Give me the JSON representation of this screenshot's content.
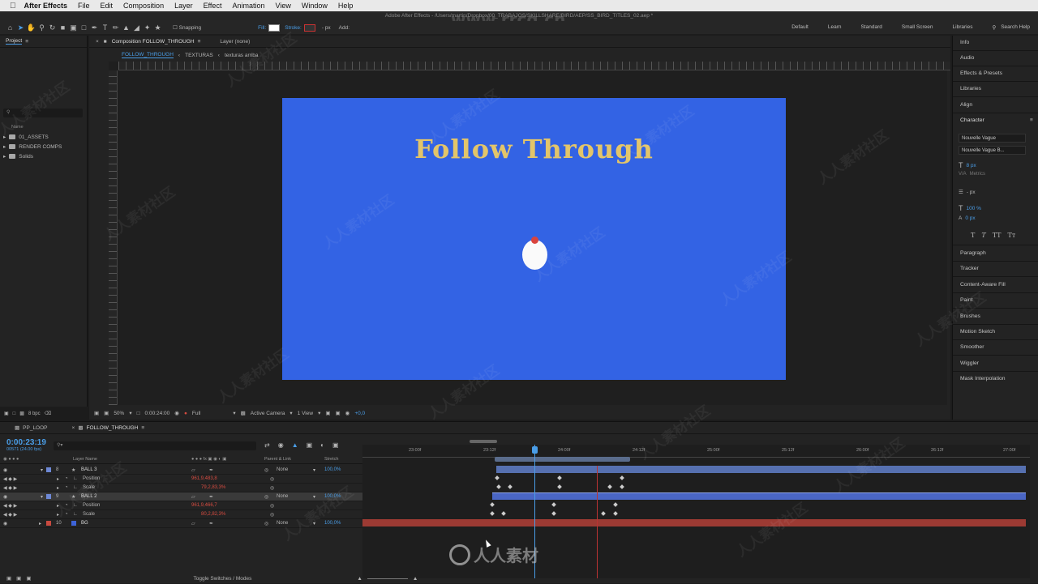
{
  "menubar": {
    "app_name": "After Effects",
    "items": [
      "File",
      "Edit",
      "Composition",
      "Layer",
      "Effect",
      "Animation",
      "View",
      "Window",
      "Help"
    ]
  },
  "window_title": "Adobe After Effects - /Users/martin/Dropbox/00_TRABAJOS/SKILLSHARE/BIRD/AEP/SS_BIRD_TITLES_02.aep *",
  "toolbar": {
    "snapping": "Snapping",
    "fill_label": "Fill:",
    "stroke_label": "Stroke:",
    "stroke_px": "- px",
    "add_label": "Add:",
    "workspaces": [
      "Default",
      "Learn",
      "Standard",
      "Small Screen",
      "Libraries"
    ],
    "search_help": "Search Help"
  },
  "project": {
    "tab": "Project",
    "col_name": "Name",
    "items": [
      "01_ASSETS",
      "RENDER COMPS",
      "Solids"
    ],
    "bpc": "8 bpc"
  },
  "comp": {
    "tab": "Composition FOLLOW_THROUGH",
    "layer_tab": "Layer (none)",
    "breadcrumbs": [
      "FOLLOW_THROUGH",
      "TEXTURAS",
      "texturas arriba"
    ],
    "title_text": "Follow Through",
    "zoom": "50%",
    "timecode": "0:00:24:00",
    "resolution": "Full",
    "camera": "Active Camera",
    "views": "1 View",
    "exposure": "+0,0"
  },
  "right_panel": {
    "items": [
      "Info",
      "Audio",
      "Effects & Presets",
      "Libraries",
      "Align"
    ],
    "character": "Character",
    "font": "Nouvelle Vague",
    "font_style": "Nouvelle Vague B...",
    "size": "8 px",
    "metrics": "Metrics",
    "leading": "- px",
    "v_scale": "100 %",
    "baseline": "0 px",
    "type_buttons": [
      "T",
      "T",
      "TT",
      "Tт"
    ],
    "lower_items": [
      "Paragraph",
      "Tracker",
      "Content-Aware Fill",
      "Paint",
      "Brushes",
      "Motion Sketch",
      "Smoother",
      "Wiggler",
      "Mask Interpolation"
    ]
  },
  "timeline": {
    "tabs": [
      "PP_LOOP",
      "FOLLOW_THROUGH"
    ],
    "timecode": "0:00:23:19",
    "fps": "00571 (24.00 fps)",
    "col_layer_name": "Layer Name",
    "col_parent": "Parent & Link",
    "col_stretch": "Stretch",
    "layers": [
      {
        "num": "8",
        "name": "BALL 3",
        "parent": "None",
        "stretch": "100,0%"
      },
      {
        "prop": "Position",
        "value": "961,9,483,8"
      },
      {
        "prop": "Scale",
        "value": "79,2,83,3%"
      },
      {
        "num": "9",
        "name": "BALL 2",
        "parent": "None",
        "stretch": "100,0%"
      },
      {
        "prop": "Position",
        "value": "961,9,466,7"
      },
      {
        "prop": "Scale",
        "value": "80,2,82,3%"
      },
      {
        "num": "10",
        "name": "BG",
        "parent": "None",
        "stretch": "100,0%"
      }
    ],
    "ruler_ticks": [
      "23:00f",
      "23:12f",
      "24:00f",
      "24:12f",
      "25:00f",
      "25:12f",
      "26:00f",
      "26:12f",
      "27:00f"
    ],
    "toggle_label": "Toggle Switches / Modes"
  },
  "watermarks": {
    "url": "www.rrcg.cn",
    "logo": "人人素材",
    "tile": "人人素材社区"
  }
}
